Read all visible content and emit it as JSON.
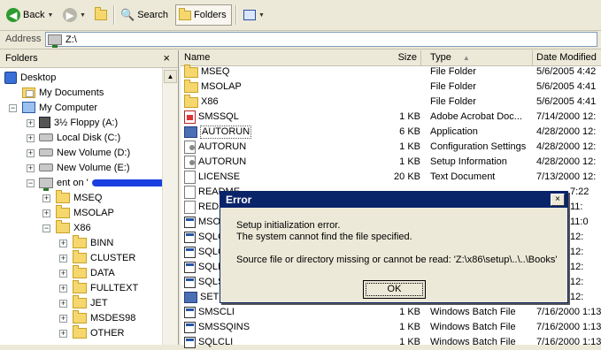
{
  "toolbar": {
    "back_label": "Back",
    "search_label": "Search",
    "folders_label": "Folders"
  },
  "address": {
    "label": "Address",
    "value": "Z:\\"
  },
  "folders_pane": {
    "title": "Folders",
    "close": "×",
    "items": [
      {
        "label": "Desktop"
      },
      {
        "label": "My Documents"
      },
      {
        "label": "My Computer"
      },
      {
        "label": "3½ Floppy (A:)"
      },
      {
        "label": "Local Disk (C:)"
      },
      {
        "label": "New Volume (D:)"
      },
      {
        "label": "New Volume (E:)"
      },
      {
        "label": "ent on '"
      },
      {
        "label": "MSEQ"
      },
      {
        "label": "MSOLAP"
      },
      {
        "label": "X86"
      },
      {
        "label": "BINN"
      },
      {
        "label": "CLUSTER"
      },
      {
        "label": "DATA"
      },
      {
        "label": "FULLTEXT"
      },
      {
        "label": "JET"
      },
      {
        "label": "MSDES98"
      },
      {
        "label": "OTHER"
      }
    ]
  },
  "file_list": {
    "columns": {
      "name": "Name",
      "size": "Size",
      "type": "Type",
      "date": "Date Modified"
    },
    "rows": [
      {
        "name": "MSEQ",
        "size": "",
        "type": "File Folder",
        "date": "5/6/2005 4:42"
      },
      {
        "name": "MSOLAP",
        "size": "",
        "type": "File Folder",
        "date": "5/6/2005 4:41"
      },
      {
        "name": "X86",
        "size": "",
        "type": "File Folder",
        "date": "5/6/2005 4:41"
      },
      {
        "name": "SMSSQL",
        "size": "1 KB",
        "type": "Adobe Acrobat Doc...",
        "date": "7/14/2000 12:"
      },
      {
        "name": "AUTORUN",
        "size": "6 KB",
        "type": "Application",
        "date": "4/28/2000 12:"
      },
      {
        "name": "AUTORUN",
        "size": "1 KB",
        "type": "Configuration Settings",
        "date": "4/28/2000 12:"
      },
      {
        "name": "AUTORUN",
        "size": "1 KB",
        "type": "Setup Information",
        "date": "4/28/2000 12:"
      },
      {
        "name": "LICENSE",
        "size": "20 KB",
        "type": "Text Document",
        "date": "7/13/2000 12:"
      },
      {
        "name": "README",
        "size": "",
        "type": "",
        "date": "7:22"
      },
      {
        "name": "REDI",
        "size": "",
        "type": "",
        "date": "11:"
      },
      {
        "name": "MSO",
        "size": "",
        "type": "",
        "date": "11:0"
      },
      {
        "name": "SQLC",
        "size": "",
        "type": "",
        "date": "12:"
      },
      {
        "name": "SQLC",
        "size": "",
        "type": "",
        "date": "12:"
      },
      {
        "name": "SQLI",
        "size": "",
        "type": "",
        "date": "12:"
      },
      {
        "name": "SQLS",
        "size": "",
        "type": "",
        "date": "12:"
      },
      {
        "name": "SETU",
        "size": "",
        "type": "",
        "date": "12:"
      },
      {
        "name": "SMSCLI",
        "size": "1 KB",
        "type": "Windows Batch File",
        "date": "7/16/2000 1:13"
      },
      {
        "name": "SMSSQINS",
        "size": "1 KB",
        "type": "Windows Batch File",
        "date": "7/16/2000 1:13"
      },
      {
        "name": "SQLCLI",
        "size": "1 KB",
        "type": "Windows Batch File",
        "date": "7/16/2000 1:13"
      }
    ]
  },
  "dialog": {
    "title": "Error",
    "close": "×",
    "line1": "Setup initialization error.",
    "line2": "The system cannot find the file specified.",
    "line3": "Source file or directory missing or cannot be read: 'Z:\\x86\\setup\\..\\..\\Books'",
    "ok_label": "OK"
  }
}
